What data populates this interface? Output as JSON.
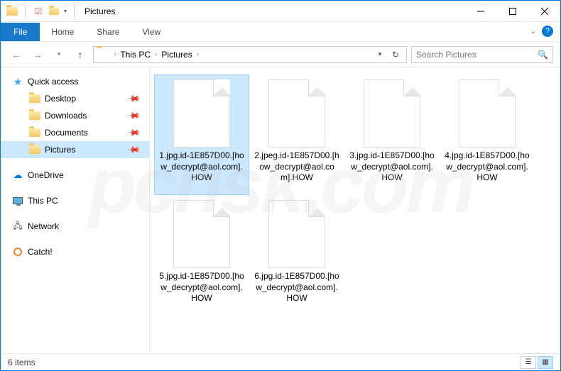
{
  "titlebar": {
    "title": "Pictures"
  },
  "ribbon": {
    "file": "File",
    "tabs": [
      "Home",
      "Share",
      "View"
    ]
  },
  "breadcrumb": {
    "items": [
      "This PC",
      "Pictures"
    ]
  },
  "search": {
    "placeholder": "Search Pictures"
  },
  "sidebar": {
    "quick_access": "Quick access",
    "quick_items": [
      {
        "label": "Desktop",
        "pinned": true
      },
      {
        "label": "Downloads",
        "pinned": true
      },
      {
        "label": "Documents",
        "pinned": true
      },
      {
        "label": "Pictures",
        "pinned": true,
        "selected": true
      }
    ],
    "onedrive": "OneDrive",
    "thispc": "This PC",
    "network": "Network",
    "catch": "Catch!"
  },
  "files": [
    {
      "name": "1.jpg.id-1E857D00.[how_decrypt@aol.com].HOW",
      "selected": true
    },
    {
      "name": "2.jpeg.id-1E857D00.[how_decrypt@aol.com].HOW"
    },
    {
      "name": "3.jpg.id-1E857D00.[how_decrypt@aol.com].HOW"
    },
    {
      "name": "4.jpg.id-1E857D00.[how_decrypt@aol.com].HOW"
    },
    {
      "name": "5.jpg.id-1E857D00.[how_decrypt@aol.com].HOW"
    },
    {
      "name": "6.jpg.id-1E857D00.[how_decrypt@aol.com].HOW"
    }
  ],
  "statusbar": {
    "count": "6 items"
  },
  "watermark": "pcrisk.com"
}
